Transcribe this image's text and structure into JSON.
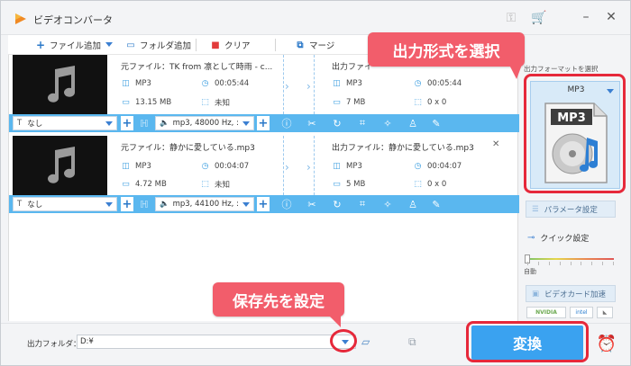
{
  "app": {
    "title": "ビデオコンバータ"
  },
  "toolbar": {
    "add_file": "ファイル追加",
    "add_folder": "フォルダ追加",
    "clear": "クリア",
    "merge": "マージ"
  },
  "files": [
    {
      "source_name": "元ファイル：TK from 凛として時雨 - c...",
      "source_format": "MP3",
      "source_duration": "00:05:44",
      "source_size": "13.15 MB",
      "source_resolution": "未知",
      "output_name": "出力ファイ",
      "output_format": "MP3",
      "output_duration": "00:05:44",
      "output_size": "7 MB",
      "output_resolution": "0 x 0",
      "subtitle": "なし",
      "audio": "mp3, 48000 Hz, :"
    },
    {
      "source_name": "元ファイル：静かに愛している.mp3",
      "source_format": "MP3",
      "source_duration": "00:04:07",
      "source_size": "4.72 MB",
      "source_resolution": "未知",
      "output_name": "出力ファイル：静かに愛している.mp3",
      "output_format": "MP3",
      "output_duration": "00:04:07",
      "output_size": "5 MB",
      "output_resolution": "0 x 0",
      "subtitle": "なし",
      "audio": "mp3, 44100 Hz, :"
    }
  ],
  "right_panel": {
    "format_label": "出力フォーマットを選択",
    "format_name": "MP3",
    "format_icon_text": "MP3",
    "param_settings": "パラメータ設定",
    "quick_settings": "クイック設定",
    "auto_label": "自動",
    "gpu_accel": "ビデオカード加速",
    "badge_nvidia": "NVIDIA",
    "badge_intel": "intel"
  },
  "bottom": {
    "output_folder_label": "出力フォルダ：",
    "output_folder_value": "D:¥",
    "convert_button": "変換"
  },
  "callouts": {
    "format": "出力形式を選択",
    "destination": "保存先を設定"
  },
  "colors": {
    "accent": "#3aa2f0",
    "bar": "#5ab7ef",
    "callout": "#f25d6b",
    "ring": "#e6283a"
  }
}
